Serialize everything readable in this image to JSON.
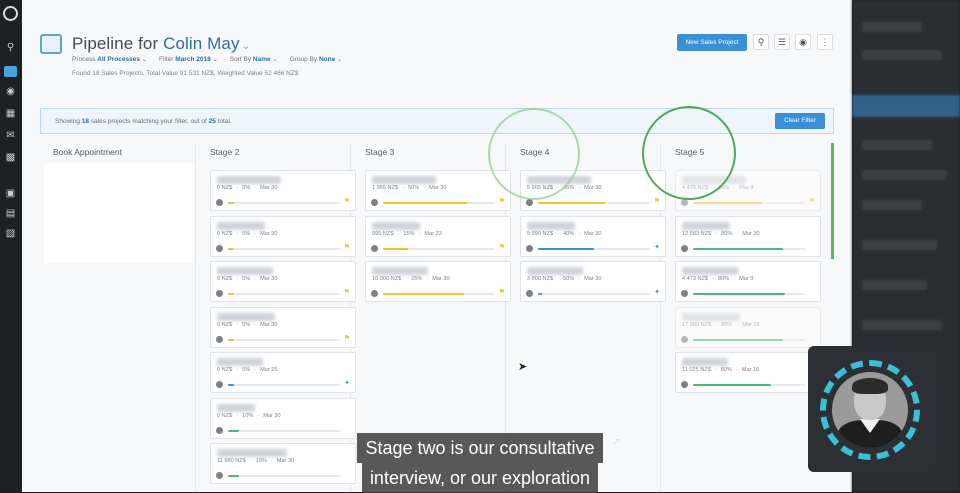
{
  "header": {
    "title_prefix": "Pipeline for",
    "owner": "Colin May",
    "filters": [
      {
        "label": "Process",
        "value": "All Processes"
      },
      {
        "label": "Filter",
        "value": "March 2018"
      },
      {
        "label": "Sort By",
        "value": "Name"
      },
      {
        "label": "Group By",
        "value": "None"
      }
    ],
    "found_text": "Found 18 Sales Projects, Total Value 91 531 NZ$, Weighted Value 52 466 NZ$"
  },
  "toolbar": {
    "new_button": "New Sales Project",
    "search_icon": "search-icon",
    "menu_icon": "list-icon",
    "view_icon": "eye-icon",
    "more_icon": "more-vertical-icon"
  },
  "banner": {
    "prefix": "Showing",
    "count": "18",
    "middle": "sales projects matching your filter, out of",
    "total": "25",
    "suffix": "total.",
    "clear_button": "Clear Filter"
  },
  "stages": [
    "Book Appointment",
    "Stage 2",
    "Stage 3",
    "Stage 4",
    "Stage 5"
  ],
  "cards": {
    "stage2": [
      {
        "amount": "0 NZ$",
        "pct": "5%",
        "date": "Mar 30",
        "progress": 0.05,
        "color": "#f0c230",
        "marker": "flag"
      },
      {
        "amount": "0 NZ$",
        "pct": "5%",
        "date": "Mar 30",
        "progress": 0.05,
        "color": "#f0c230",
        "marker": "flag"
      },
      {
        "amount": "0 NZ$",
        "pct": "5%",
        "date": "Mar 30",
        "progress": 0.05,
        "color": "#f0c230",
        "marker": "flag"
      },
      {
        "amount": "0 NZ$",
        "pct": "5%",
        "date": "Mar 30",
        "progress": 0.05,
        "color": "#f0c230",
        "marker": "flag"
      },
      {
        "amount": "0 NZ$",
        "pct": "5%",
        "date": "Mar 25",
        "progress": 0.05,
        "color": "#3a8fd6",
        "marker": "puzzle"
      },
      {
        "amount": "0 NZ$",
        "pct": "10%",
        "date": "Mar 30",
        "progress": 0.1,
        "color": "#4cb872",
        "marker": ""
      },
      {
        "amount": "11 980 NZ$",
        "pct": "10%",
        "date": "Mar 30",
        "progress": 0.1,
        "color": "#4cb872",
        "marker": ""
      }
    ],
    "stage3": [
      {
        "amount": "1 965 NZ$",
        "pct": "50%",
        "date": "Mar 30",
        "progress": 0.75,
        "color": "#f0c230",
        "marker": "flag"
      },
      {
        "amount": "995 NZ$",
        "pct": "15%",
        "date": "Mar 23",
        "progress": 0.22,
        "color": "#f0c230",
        "marker": "flag"
      },
      {
        "amount": "10 000 NZ$",
        "pct": "25%",
        "date": "Mar 30",
        "progress": 0.72,
        "color": "#f0c230",
        "marker": "flag"
      }
    ],
    "stage4": [
      {
        "amount": "5 565 NZ$",
        "pct": "45%",
        "date": "Mar 30",
        "progress": 0.6,
        "color": "#f0c230",
        "marker": "flag"
      },
      {
        "amount": "5 990 NZ$",
        "pct": "40%",
        "date": "Mar 30",
        "progress": 0.5,
        "color": "#3a8fd6",
        "marker": "puzzle"
      },
      {
        "amount": "3 800 NZ$",
        "pct": "50%",
        "date": "Mar 30",
        "progress": 0.04,
        "color": "#3a8fd6",
        "marker": "puzzle"
      }
    ],
    "stage5": [
      {
        "amount": "4 475 NZ$",
        "pct": "45%",
        "date": "Mar 9",
        "progress": 0.62,
        "color": "#f0c230",
        "marker": "flag",
        "faded": true
      },
      {
        "amount": "12 583 NZ$",
        "pct": "80%",
        "date": "Mar 30",
        "progress": 0.8,
        "color": "#4cb872",
        "marker": ""
      },
      {
        "amount": "4 473 NZ$",
        "pct": "80%",
        "date": "Mar 9",
        "progress": 0.82,
        "color": "#4cb872",
        "marker": ""
      },
      {
        "amount": "17 900 NZ$",
        "pct": "80%",
        "date": "Mar 16",
        "progress": 0.8,
        "color": "#4cb872",
        "marker": "",
        "faded": true
      },
      {
        "amount": "11 025 NZ$",
        "pct": "80%",
        "date": "Mar 16",
        "progress": 0.7,
        "color": "#4cb872",
        "marker": ""
      }
    ]
  },
  "caption": {
    "line1": "Stage two is our consultative",
    "line2": "interview, or our exploration"
  }
}
